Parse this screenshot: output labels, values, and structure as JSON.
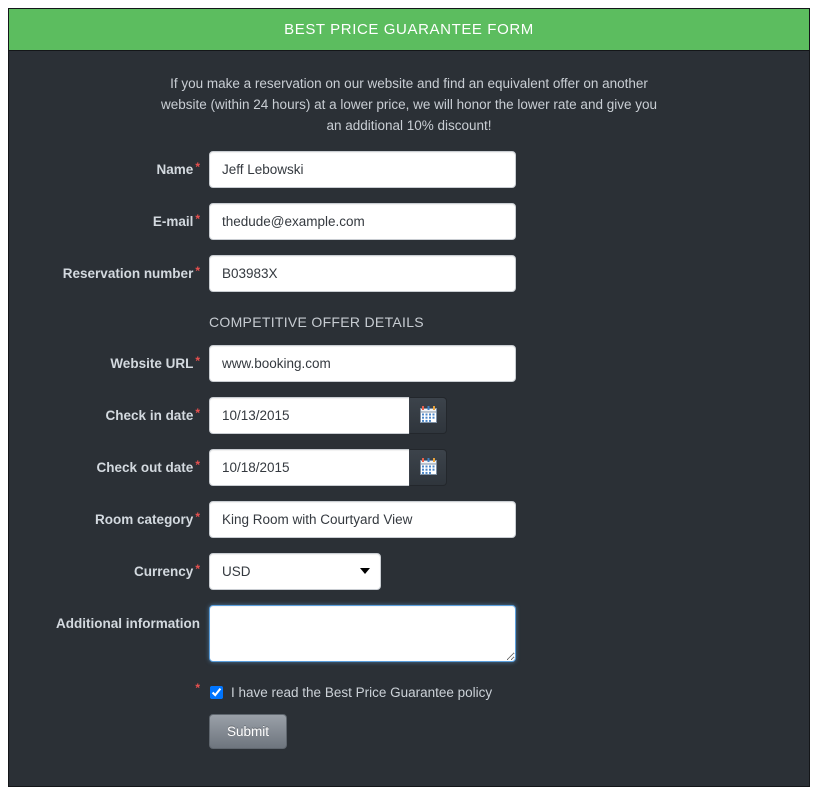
{
  "panel": {
    "header_title": "BEST PRICE GUARANTEE FORM",
    "header_color": "#5cbd5f",
    "body_color": "#2b3036",
    "intro": "If you make a reservation on our website and find an equivalent offer on another website (within 24 hours) at a lower price, we will honor the lower rate and give you an additional 10% discount!"
  },
  "fields": {
    "name": {
      "label": "Name",
      "required": "*",
      "value": "Jeff Lebowski"
    },
    "email": {
      "label": "E-mail",
      "required": "*",
      "value": "thedude@example.com"
    },
    "reservation_number": {
      "label": "Reservation number",
      "required": "*",
      "value": "B03983X"
    },
    "website_url": {
      "label": "Website URL",
      "required": "*",
      "value": "www.booking.com"
    },
    "check_in": {
      "label": "Check in date",
      "required": "*",
      "value": "10/13/2015",
      "icon": "calendar-icon"
    },
    "check_out": {
      "label": "Check out date",
      "required": "*",
      "value": "10/18/2015",
      "icon": "calendar-icon"
    },
    "room_category": {
      "label": "Room category",
      "required": "*",
      "value": "King Room with Courtyard View"
    },
    "currency": {
      "label": "Currency",
      "required": "*",
      "value": "USD",
      "options": [
        "USD"
      ]
    },
    "additional_information": {
      "label": "Additional information",
      "value": "",
      "placeholder": ""
    }
  },
  "section": {
    "competitive_offer_title": "COMPETITIVE OFFER DETAILS"
  },
  "consent": {
    "required": "*",
    "label": "I have read the Best Price Guarantee policy",
    "checked": true
  },
  "submit": {
    "label": "Submit"
  },
  "colors": {
    "required_asterisk": "#e8504f",
    "label_text": "#d3d9df",
    "focus_border": "#5b9fdd"
  }
}
